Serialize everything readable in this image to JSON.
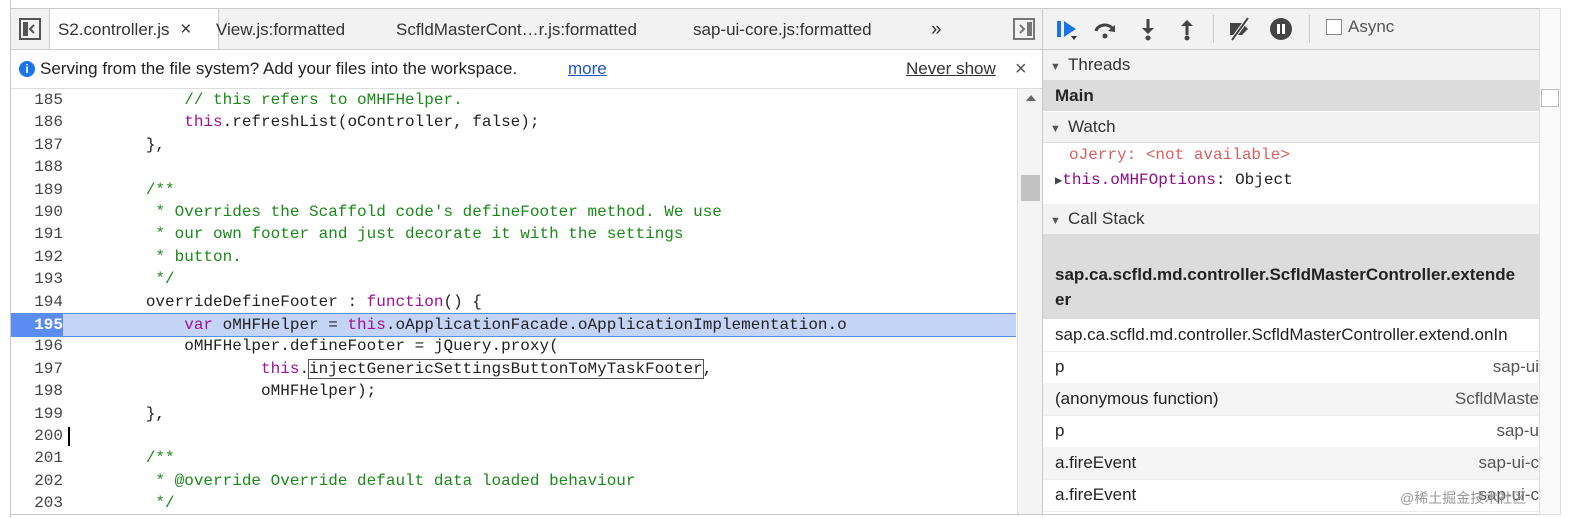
{
  "editor": {
    "tabs": [
      {
        "label": "S2.controller.js",
        "active": true,
        "close": "×"
      },
      {
        "label": "View.js:formatted",
        "active": false
      },
      {
        "label": "ScfldMasterCont…r.js:formatted",
        "active": false
      },
      {
        "label": "sap-ui-core.js:formatted",
        "active": false
      }
    ],
    "overflow_label": "»",
    "infobar": {
      "message": "Serving from the file system? Add your files into the workspace.",
      "link": "more",
      "never_show": "Never show",
      "close": "×"
    },
    "highlight_line": "195",
    "lines": [
      {
        "num": "185",
        "text": "            // this refers to oMHFHelper."
      },
      {
        "num": "186",
        "text": "            this.refreshList(oController, false);"
      },
      {
        "num": "187",
        "text": "        },"
      },
      {
        "num": "188",
        "text": ""
      },
      {
        "num": "189",
        "text": "        /**"
      },
      {
        "num": "190",
        "text": "         * Overrides the Scaffold code's defineFooter method. We use"
      },
      {
        "num": "191",
        "text": "         * our own footer and just decorate it with the settings"
      },
      {
        "num": "192",
        "text": "         * button."
      },
      {
        "num": "193",
        "text": "         */"
      },
      {
        "num": "194",
        "text": "        overrideDefineFooter : function() {"
      },
      {
        "num": "195",
        "text": "            var oMHFHelper = this.oApplicationFacade.oApplicationImplementation.o"
      },
      {
        "num": "196",
        "text": "            oMHFHelper.defineFooter = jQuery.proxy("
      },
      {
        "num": "197",
        "text": "                    this.injectGenericSettingsButtonToMyTaskFooter,"
      },
      {
        "num": "198",
        "text": "                    oMHFHelper);"
      },
      {
        "num": "199",
        "text": "        },"
      },
      {
        "num": "200",
        "text": ""
      },
      {
        "num": "201",
        "text": "        /**"
      },
      {
        "num": "202",
        "text": "         * @override Override default data loaded behaviour"
      },
      {
        "num": "203",
        "text": "         */"
      }
    ]
  },
  "debugger": {
    "async_label": "Async",
    "threads": {
      "title": "Threads",
      "main": "Main"
    },
    "watch": {
      "title": "Watch",
      "items": [
        {
          "name": "oJerry",
          "value": "<not available>"
        },
        {
          "name": "this.oMHFOptions",
          "value": "Object"
        }
      ]
    },
    "callstack": {
      "title": "Call Stack",
      "frames": [
        {
          "fn": "sap.ca.scfld.md.controller.ScfldMasterController.extende",
          "fn2": "er",
          "file": ""
        },
        {
          "fn": "sap.ca.scfld.md.controller.ScfldMasterController.extend.onIn",
          "file": ""
        },
        {
          "fn": "p",
          "file": "sap-ui"
        },
        {
          "fn": "(anonymous function)",
          "file": "ScfldMaste"
        },
        {
          "fn": "p",
          "file": "sap-u"
        },
        {
          "fn": "a.fireEvent",
          "file": "sap-ui-c"
        },
        {
          "fn": "a.fireEvent",
          "file": "sap-ui-c"
        }
      ]
    }
  },
  "watermark": "@稀土掘金技术社区",
  "colors": {
    "highlight": "#c3d4f7",
    "highlight_border": "#5b8cf0",
    "comment": "#1a8a1a",
    "keyword": "#a0109c",
    "accent": "#1a73e8"
  }
}
